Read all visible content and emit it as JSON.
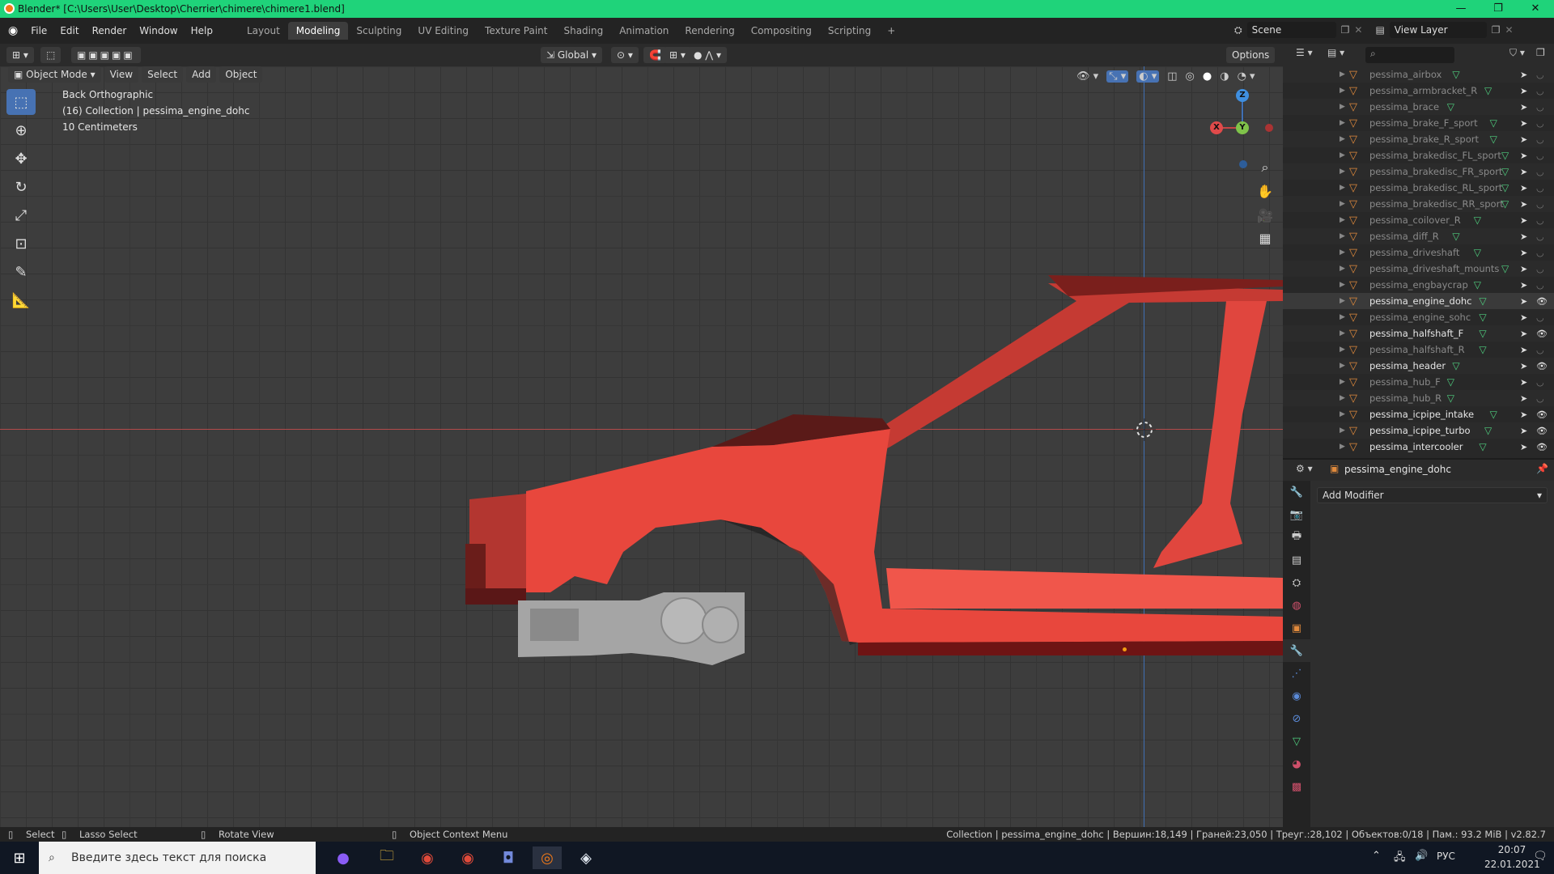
{
  "window": {
    "title": "Blender* [C:\\Users\\User\\Desktop\\Cherrier\\chimere\\chimere1.blend]",
    "min": "—",
    "max": "❐",
    "close": "✕"
  },
  "menu": [
    "File",
    "Edit",
    "Render",
    "Window",
    "Help"
  ],
  "workspaces": [
    "Layout",
    "Modeling",
    "Sculpting",
    "UV Editing",
    "Texture Paint",
    "Shading",
    "Animation",
    "Rendering",
    "Compositing",
    "Scripting"
  ],
  "active_workspace": "Modeling",
  "add_workspace": "+",
  "scene": {
    "name": "Scene",
    "view_layer": "View Layer"
  },
  "viewport_header": {
    "mode": "Object Mode",
    "menus": [
      "View",
      "Select",
      "Add",
      "Object"
    ],
    "transform": "Global",
    "options": "Options"
  },
  "viewport_overlay": {
    "view": "Back Orthographic",
    "collection": "(16) Collection | pessima_engine_dohc",
    "scale": "10 Centimeters"
  },
  "gizmo": {
    "x": "X",
    "y": "Y",
    "z": "Z"
  },
  "outliner": {
    "search_placeholder": "",
    "rows": [
      {
        "name": "pessima_airbox",
        "visible": false,
        "active": false
      },
      {
        "name": "pessima_armbracket_R",
        "visible": false,
        "active": false
      },
      {
        "name": "pessima_brace",
        "visible": false,
        "active": false
      },
      {
        "name": "pessima_brake_F_sport",
        "visible": false,
        "active": false
      },
      {
        "name": "pessima_brake_R_sport",
        "visible": false,
        "active": false
      },
      {
        "name": "pessima_brakedisc_FL_sport",
        "visible": false,
        "active": false
      },
      {
        "name": "pessima_brakedisc_FR_sport",
        "visible": false,
        "active": false
      },
      {
        "name": "pessima_brakedisc_RL_sport",
        "visible": false,
        "active": false
      },
      {
        "name": "pessima_brakedisc_RR_sport",
        "visible": false,
        "active": false
      },
      {
        "name": "pessima_coilover_R",
        "visible": false,
        "active": false
      },
      {
        "name": "pessima_diff_R",
        "visible": false,
        "active": false
      },
      {
        "name": "pessima_driveshaft",
        "visible": false,
        "active": false
      },
      {
        "name": "pessima_driveshaft_mounts",
        "visible": false,
        "active": false
      },
      {
        "name": "pessima_engbaycrap",
        "visible": false,
        "active": false
      },
      {
        "name": "pessima_engine_dohc",
        "visible": true,
        "active": true
      },
      {
        "name": "pessima_engine_sohc",
        "visible": false,
        "active": false
      },
      {
        "name": "pessima_halfshaft_F",
        "visible": true,
        "active": false
      },
      {
        "name": "pessima_halfshaft_R",
        "visible": false,
        "active": false
      },
      {
        "name": "pessima_header",
        "visible": true,
        "active": false
      },
      {
        "name": "pessima_hub_F",
        "visible": false,
        "active": false
      },
      {
        "name": "pessima_hub_R",
        "visible": false,
        "active": false
      },
      {
        "name": "pessima_icpipe_intake",
        "visible": true,
        "active": false
      },
      {
        "name": "pessima_icpipe_turbo",
        "visible": true,
        "active": false
      },
      {
        "name": "pessima_intercooler",
        "visible": true,
        "active": false
      }
    ]
  },
  "properties": {
    "object_name": "pessima_engine_dohc",
    "add_modifier": "Add Modifier"
  },
  "statusbar": {
    "select": "Select",
    "lasso": "Lasso Select",
    "rotate": "Rotate View",
    "context": "Object Context Menu",
    "stats": "Collection | pessima_engine_dohc | Вершин:18,149 | Граней:23,050 | Треуг.:28,102 | Объектов:0/18 | Пам.: 93.2 MiB | v2.82.7"
  },
  "taskbar": {
    "search_placeholder": "Введите здесь текст для поиска",
    "lang": "РУС",
    "time": "20:07",
    "date": "22.01.2021"
  },
  "colors": {
    "accent": "#4772b3",
    "title_green": "#1fd37a",
    "car_red": "#e8473d"
  }
}
